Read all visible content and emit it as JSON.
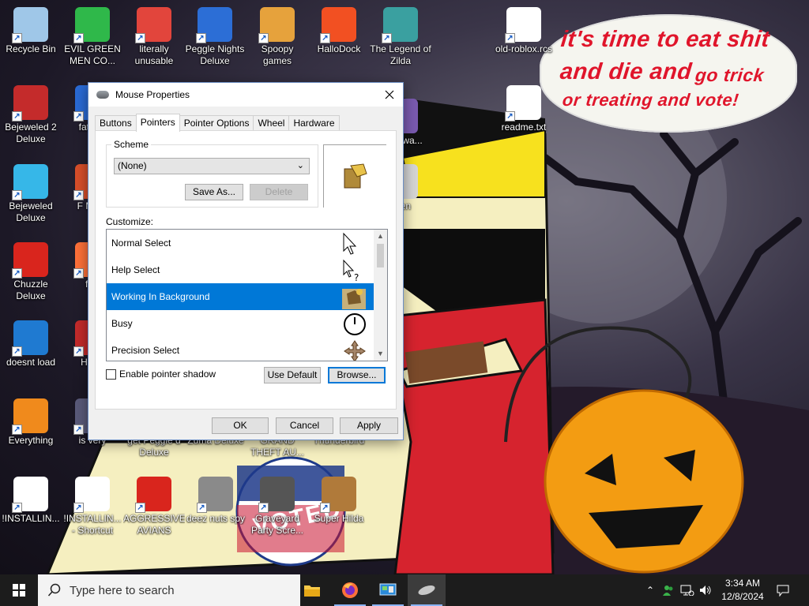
{
  "wallpaper": {
    "speech": [
      "it's time to eat shit",
      "and die and",
      "go trick",
      "or treating and vote!"
    ],
    "badge_text": "VOTED"
  },
  "desktop_icons": [
    {
      "label": "Recycle Bin",
      "icon": "recycle-bin-icon",
      "color": "#9fc7e8"
    },
    {
      "label": "EVIL GREEN MEN CO...",
      "icon": "green-men-icon",
      "color": "#2fb84a"
    },
    {
      "label": "literally unusable",
      "icon": "chrome-icon",
      "color": "#e2453c"
    },
    {
      "label": "Peggle Nights Deluxe",
      "icon": "peggle-icon",
      "color": "#2c6ed6"
    },
    {
      "label": "Spoopy games",
      "icon": "folder-icon",
      "color": "#e6a23c"
    },
    {
      "label": "HalloDock",
      "icon": "windows-logo-icon",
      "color": "#f25022"
    },
    {
      "label": "The Legend of Zilda",
      "icon": "zelda-game-icon",
      "color": "#3aa0a0"
    },
    {
      "label": "old-roblox.rcs",
      "icon": "file-icon",
      "color": "#ffffff"
    },
    {
      "label": "Bejeweled 2 Deluxe",
      "icon": "bejeweled2-icon",
      "color": "#c42b2b"
    },
    {
      "label": "fat like",
      "icon": "unknown-app-icon",
      "color": "#2a6bd6"
    },
    {
      "label": "readme.txt",
      "icon": "text-file-icon",
      "color": "#ffffff"
    },
    {
      "label": "Bejeweled Deluxe",
      "icon": "gem-icon",
      "color": "#36b7e8"
    },
    {
      "label": "F MON",
      "icon": "unknown-app-icon",
      "color": "#d94f2a"
    },
    {
      "label": "Chuzzle Deluxe",
      "icon": "chuzzle-icon",
      "color": "#d9251d"
    },
    {
      "label": "furr",
      "icon": "firefox-icon",
      "color": "#ff7139"
    },
    {
      "label": "doesnt load",
      "icon": "thunderbird-icon",
      "color": "#1f7ad1"
    },
    {
      "label": "H We",
      "icon": "unknown-app-icon",
      "color": "#c42b2b"
    },
    {
      "label": "Everything",
      "icon": "search-magnifier-icon",
      "color": "#f08a1c"
    },
    {
      "label": "is very",
      "icon": "unknown-app-icon",
      "color": "#5a5a7a"
    },
    {
      "label": "get Peggle d Deluxe",
      "icon": "unknown-app-icon",
      "color": "#2c6ed6"
    },
    {
      "label": "Zuma Deluxe",
      "icon": "unknown-app-icon",
      "color": "#3a8a3a"
    },
    {
      "label": "GRAND THEFT AU...",
      "icon": "unknown-app-icon",
      "color": "#6a6a6a"
    },
    {
      "label": "Thunderbird",
      "icon": "unknown-app-icon",
      "color": "#1f7ad1"
    },
    {
      "label": "!INSTALLIN...",
      "icon": "text-file-icon",
      "color": "#ffffff"
    },
    {
      "label": "!INSTALLIN... - Shortcut",
      "icon": "text-file-icon",
      "color": "#ffffff"
    },
    {
      "label": "AGGRESSIVE AVIANS",
      "icon": "angry-bird-icon",
      "color": "#d9251d"
    },
    {
      "label": "deez nuts spy",
      "icon": "windows-stack-icon",
      "color": "#8a8a8a"
    },
    {
      "label": "Graveyard Party Scre...",
      "icon": "graveyard-icon",
      "color": "#555"
    },
    {
      "label": "Super Hilda",
      "icon": "pixel-cat-icon",
      "color": "#b07a3a"
    },
    {
      "label": "boo nwa...",
      "icon": "unknown-app-icon",
      "color": "#7a5ab0"
    },
    {
      "label": "veen",
      "icon": "unknown-app-icon",
      "color": "#d6d6d6"
    }
  ],
  "dialog": {
    "title": "Mouse Properties",
    "tabs": [
      "Buttons",
      "Pointers",
      "Pointer Options",
      "Wheel",
      "Hardware"
    ],
    "active_tab": "Pointers",
    "scheme": {
      "group_label": "Scheme",
      "selected": "(None)",
      "save_as": "Save As...",
      "delete": "Delete"
    },
    "customize_label": "Customize:",
    "cursors": [
      {
        "name": "Normal Select",
        "icon": "arrow-cursor-icon",
        "selected": false
      },
      {
        "name": "Help Select",
        "icon": "help-cursor-icon",
        "selected": false
      },
      {
        "name": "Working In Background",
        "icon": "custom-animated-cursor-icon",
        "selected": true
      },
      {
        "name": "Busy",
        "icon": "busy-clock-cursor-icon",
        "selected": false
      },
      {
        "name": "Precision Select",
        "icon": "move-cursor-icon",
        "selected": false
      }
    ],
    "shadow_label": "Enable pointer shadow",
    "shadow_checked": false,
    "use_default": "Use Default",
    "browse": "Browse...",
    "ok": "OK",
    "cancel": "Cancel",
    "apply": "Apply"
  },
  "taskbar": {
    "search_placeholder": "Type here to search",
    "apps": [
      "file-explorer-icon",
      "firefox-icon",
      "control-panel-icon",
      "mouse-icon"
    ],
    "time": "3:34 AM",
    "date": "12/8/2024"
  }
}
